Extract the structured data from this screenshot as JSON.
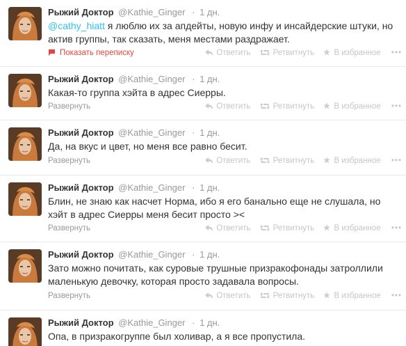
{
  "tweets": [
    {
      "fullname": "Рыжий Доктор",
      "username": "@Kathie_Ginger",
      "time": "1 дн.",
      "mention": "@cathy_hiatt",
      "text": " я люблю их за апдейты, новую инфу и инсайдерские штуки, но актив группы, так сказать, меня местами раздражает.",
      "footer_link": "Показать переписку"
    },
    {
      "fullname": "Рыжий Доктор",
      "username": "@Kathie_Ginger",
      "time": "1 дн.",
      "text": "Какая-то группа хэйта в адрес Сиерры.",
      "footer_link": "Развернуть"
    },
    {
      "fullname": "Рыжий Доктор",
      "username": "@Kathie_Ginger",
      "time": "1 дн.",
      "text": "Да, на вкус и цвет, но меня все равно бесит.",
      "footer_link": "Развернуть"
    },
    {
      "fullname": "Рыжий Доктор",
      "username": "@Kathie_Ginger",
      "time": "1 дн.",
      "text": "Блин, не знаю как насчет Норма, ибо я его банально еще не слушала, но хэйт в адрес Сиерры меня бесит просто ><",
      "footer_link": "Развернуть"
    },
    {
      "fullname": "Рыжий Доктор",
      "username": "@Kathie_Ginger",
      "time": "1 дн.",
      "text": "Зато можно почитать, как суровые трушные призракофонады затроллили маленькую девочку, которая просто задавала вопросы.",
      "footer_link": "Развернуть"
    },
    {
      "fullname": "Рыжий Доктор",
      "username": "@Kathie_Ginger",
      "time": "1 дн.",
      "text": "Опа, в призракогруппе был холивар, а я все пропустила.",
      "footer_link": ""
    }
  ],
  "actions": {
    "reply": "Ответить",
    "retweet": "Ретвитнуть",
    "favorite": "В избранное",
    "more": "•••"
  },
  "colors": {
    "mention": "#2fc2ef",
    "conversation": "#e2463f",
    "muted": "#999999"
  }
}
